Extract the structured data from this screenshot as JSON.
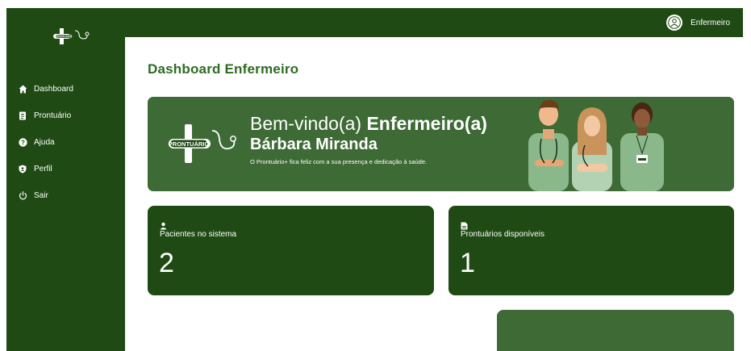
{
  "app": {
    "logo_text": "PRONTUÁRIO"
  },
  "sidebar": {
    "items": [
      {
        "label": "Dashboard",
        "icon": "home-icon"
      },
      {
        "label": "Prontuário",
        "icon": "document-icon"
      },
      {
        "label": "Ajuda",
        "icon": "help-icon"
      },
      {
        "label": "Perfil",
        "icon": "shield-icon"
      },
      {
        "label": "Sair",
        "icon": "power-icon"
      }
    ]
  },
  "header": {
    "user_role": "Enfermeiro"
  },
  "main": {
    "title": "Dashboard Enfermeiro",
    "banner": {
      "welcome_prefix": "Bem-vindo(a) ",
      "welcome_role": "Enfermeiro(a)",
      "user_name": "Bárbara Miranda",
      "message": "O Prontuário+ fica feliz com a sua presença e dedicação à saúde."
    },
    "cards": [
      {
        "label": "Pacientes no sistema",
        "value": "2",
        "icon": "user-icon"
      },
      {
        "label": "Prontuários disponíveis",
        "value": "1",
        "icon": "file-icon"
      }
    ]
  },
  "colors": {
    "dark_green": "#1f4a14",
    "medium_green": "#3e6a36",
    "title_green": "#2e6b22"
  }
}
